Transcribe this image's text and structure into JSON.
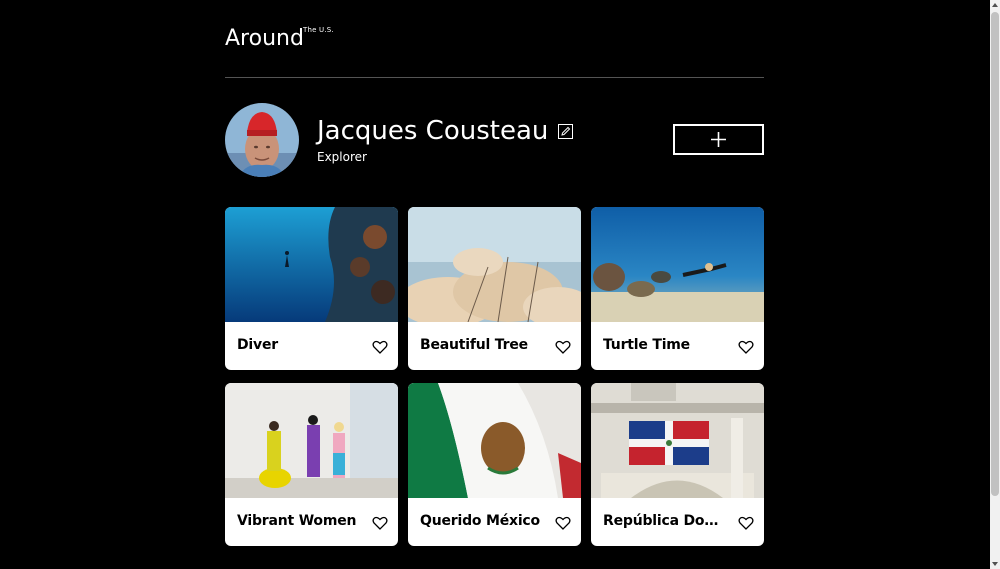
{
  "header": {
    "logo_text": "Around",
    "logo_sup": "The U.S."
  },
  "profile": {
    "name": "Jacques Cousteau",
    "job": "Explorer",
    "avatar_icon": "avatar-photo",
    "edit_icon": "pencil-icon",
    "add_icon": "plus-icon"
  },
  "cards": [
    {
      "title": "Diver",
      "image": "diver-underwater-photo",
      "icon": "heart-icon"
    },
    {
      "title": "Beautiful Tree",
      "image": "blossom-tree-photo",
      "icon": "heart-icon"
    },
    {
      "title": "Turtle Time",
      "image": "turtle-diver-photo",
      "icon": "heart-icon"
    },
    {
      "title": "Vibrant Women",
      "image": "women-gallery-photo",
      "icon": "heart-icon"
    },
    {
      "title": "Querido México",
      "image": "mexico-flag-photo",
      "icon": "heart-icon"
    },
    {
      "title": "República Dominicana",
      "image": "dominican-flag-photo",
      "icon": "heart-icon"
    }
  ],
  "colors": {
    "background": "#000000",
    "card": "#ffffff",
    "divider": "#545454"
  }
}
